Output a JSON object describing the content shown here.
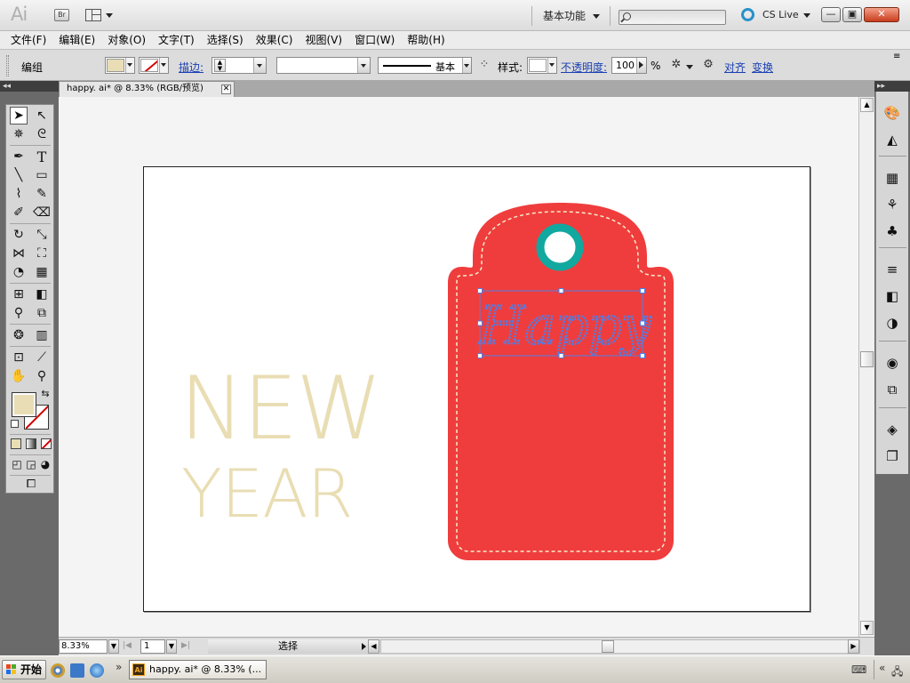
{
  "app": {
    "logo": "Ai",
    "bridge_label": "Br",
    "workspace_label": "基本功能",
    "cslive_label": "CS Live",
    "window_minimize": "—",
    "window_restore": "▣",
    "window_close": "✕"
  },
  "menu": {
    "items": [
      "文件(F)",
      "编辑(E)",
      "对象(O)",
      "文字(T)",
      "选择(S)",
      "效果(C)",
      "视图(V)",
      "窗口(W)",
      "帮助(H)"
    ]
  },
  "control_bar": {
    "selection_label": "编组",
    "fill_color": "#e8ddb5",
    "stroke_link": "描边:",
    "stroke_style_label": "基本",
    "style_label": "样式:",
    "opacity_link": "不透明度:",
    "opacity_value": "100",
    "opacity_unit": "%",
    "align_link": "对齐",
    "transform_link": "变换",
    "panel_menu": "≡"
  },
  "document": {
    "tab_title": "happy. ai* @ 8.33% (RGB/预览)",
    "tab_close": "✕",
    "zoom_value": "8.33%",
    "page_value": "1",
    "status_text": "选择"
  },
  "artwork": {
    "headline_line1": "NEW",
    "headline_line2": "YEAR",
    "tag_text": "Happy",
    "tag_color": "#ef3d3d",
    "headline_color": "#e9ddb3",
    "ring_color": "#11a8a0",
    "selection_color": "#4f7fe8"
  },
  "taskbar": {
    "start_label": "开始",
    "task_title": "happy. ai* @ 8.33% (...",
    "task_badge": "Ai",
    "tray_expand": "«"
  }
}
